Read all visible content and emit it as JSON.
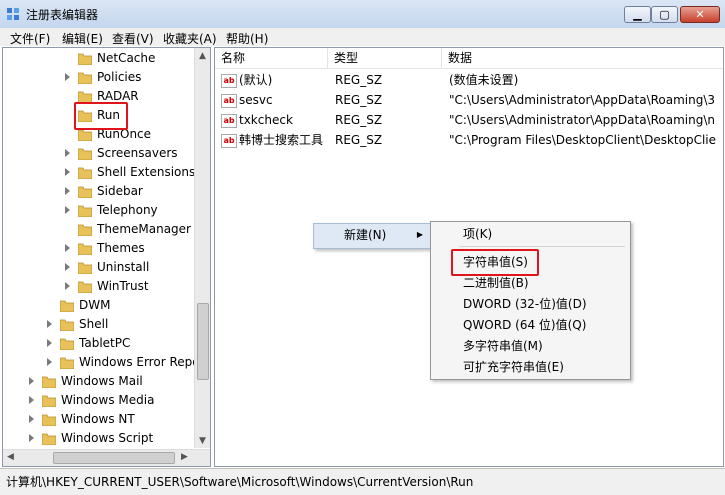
{
  "window": {
    "title": "注册表编辑器"
  },
  "menubar": [
    "文件(F)",
    "编辑(E)",
    "查看(V)",
    "收藏夹(A)",
    "帮助(H)"
  ],
  "tree": {
    "items": [
      {
        "label": "NetCache",
        "arrow": false
      },
      {
        "label": "Policies",
        "arrow": true
      },
      {
        "label": "RADAR",
        "arrow": false
      },
      {
        "label": "Run",
        "arrow": false
      },
      {
        "label": "RunOnce",
        "arrow": false
      },
      {
        "label": "Screensavers",
        "arrow": true
      },
      {
        "label": "Shell Extensions",
        "arrow": true
      },
      {
        "label": "Sidebar",
        "arrow": true
      },
      {
        "label": "Telephony",
        "arrow": true
      },
      {
        "label": "ThemeManager",
        "arrow": false
      },
      {
        "label": "Themes",
        "arrow": true
      },
      {
        "label": "Uninstall",
        "arrow": true
      },
      {
        "label": "WinTrust",
        "arrow": true
      },
      {
        "label": "DWM",
        "arrow": false
      },
      {
        "label": "Shell",
        "arrow": true
      },
      {
        "label": "TabletPC",
        "arrow": true
      },
      {
        "label": "Windows Error Repo",
        "arrow": true
      },
      {
        "label": "Windows Mail",
        "arrow": true
      },
      {
        "label": "Windows Media",
        "arrow": true
      },
      {
        "label": "Windows NT",
        "arrow": true
      },
      {
        "label": "Windows Script",
        "arrow": true
      }
    ]
  },
  "list": {
    "headers": {
      "name": "名称",
      "type": "类型",
      "data": "数据"
    },
    "rows": [
      {
        "name": "(默认)",
        "type": "REG_SZ",
        "data": "(数值未设置)"
      },
      {
        "name": "sesvc",
        "type": "REG_SZ",
        "data": "\"C:\\Users\\Administrator\\AppData\\Roaming\\3"
      },
      {
        "name": "txkcheck",
        "type": "REG_SZ",
        "data": "\"C:\\Users\\Administrator\\AppData\\Roaming\\n"
      },
      {
        "name": "韩博士搜索工具",
        "type": "REG_SZ",
        "data": "\"C:\\Program Files\\DesktopClient\\DesktopClie"
      }
    ]
  },
  "context_menu": {
    "new_label": "新建(N)"
  },
  "submenu": {
    "items": [
      "项(K)",
      "字符串值(S)",
      "二进制值(B)",
      "DWORD (32-位)值(D)",
      "QWORD (64 位)值(Q)",
      "多字符串值(M)",
      "可扩充字符串值(E)"
    ]
  },
  "statusbar": {
    "path": "计算机\\HKEY_CURRENT_USER\\Software\\Microsoft\\Windows\\CurrentVersion\\Run"
  },
  "colors": {
    "highlight_box": "#e0151b",
    "folder": "#e8c15a"
  }
}
